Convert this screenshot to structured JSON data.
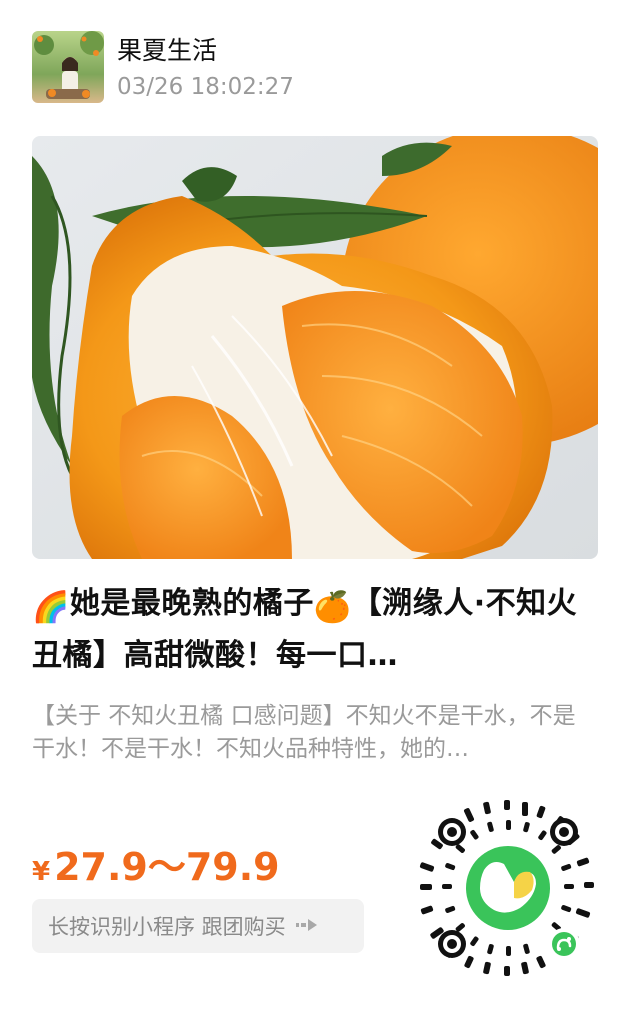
{
  "account": {
    "name": "果夏生活",
    "timestamp": "03/26 18:02:27"
  },
  "post": {
    "title_part1": "她是最晚熟的橘子",
    "title_part2": "【溯缘人·不知火丑橘】高甜微酸！每一口…",
    "description": "【关于 不知火丑橘 口感问题】不知火不是干水，不是干水！不是干水！不知火品种特性，她的…",
    "emoji_left": "🌈",
    "emoji_mid": "🍊"
  },
  "price": {
    "currency": "¥",
    "range": "27.9～79.9"
  },
  "action": {
    "label": "长按识别小程序 跟团购买"
  },
  "colors": {
    "price": "#f06a1c",
    "qr_center": "#3ac45a"
  }
}
